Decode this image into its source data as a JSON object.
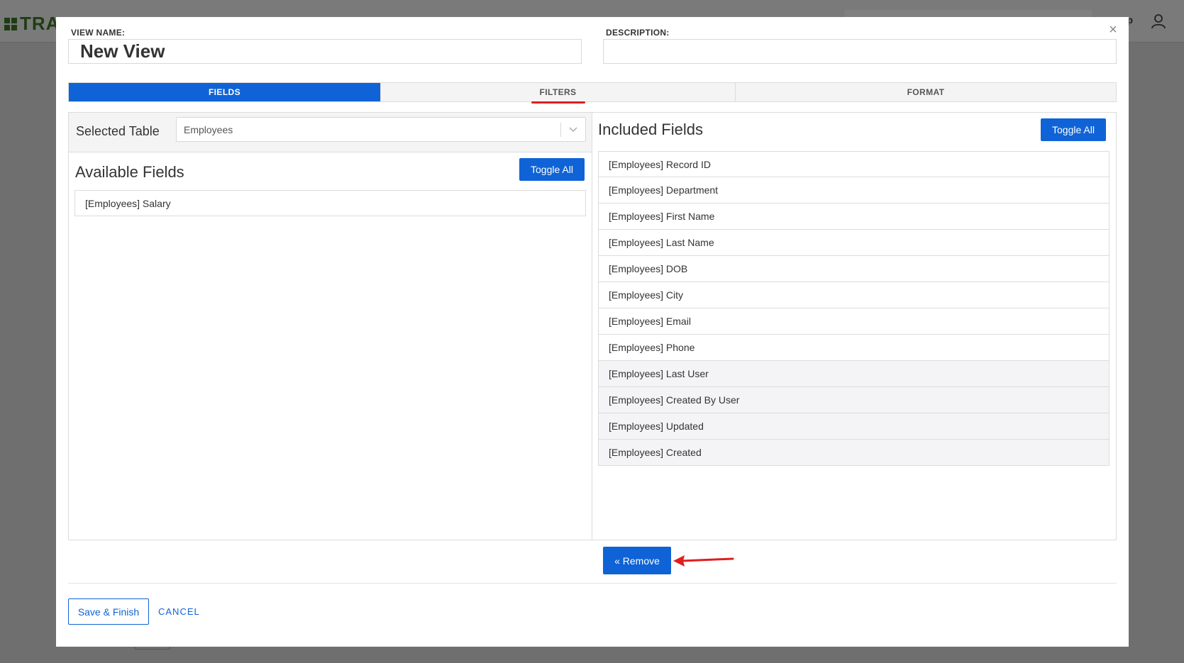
{
  "background": {
    "brand_text": "TRA",
    "help_text": "p"
  },
  "view": {
    "name_label": "VIEW NAME:",
    "name_value": "New View",
    "description_label": "DESCRIPTION:",
    "description_value": ""
  },
  "tabs": [
    {
      "label": "FIELDS",
      "active": true
    },
    {
      "label": "FILTERS",
      "active": false
    },
    {
      "label": "FORMAT",
      "active": false
    }
  ],
  "left_panel": {
    "selected_table_label": "Selected Table",
    "selected_table_value": "Employees",
    "title": "Available Fields",
    "toggle_label": "Toggle All",
    "items": [
      "[Employees] Salary"
    ]
  },
  "right_panel": {
    "title": "Included Fields",
    "toggle_label": "Toggle All",
    "items": [
      "[Employees] Record ID",
      "[Employees] Department",
      "[Employees] First Name",
      "[Employees] Last Name",
      "[Employees] DOB",
      "[Employees] City",
      "[Employees] Email",
      "[Employees] Phone",
      "[Employees] Last User",
      "[Employees] Created By User",
      "[Employees] Updated",
      "[Employees] Created"
    ]
  },
  "actions": {
    "remove_label": "« Remove",
    "save_label": "Save & Finish",
    "cancel_label": "CANCEL"
  },
  "colors": {
    "accent": "#0f63d6",
    "annotation": "#e01e1e"
  },
  "icons": {
    "close": "close-icon",
    "chevron": "chevron-down-icon",
    "user": "user-icon",
    "annotation_arrow": "red-arrow-annotation"
  }
}
